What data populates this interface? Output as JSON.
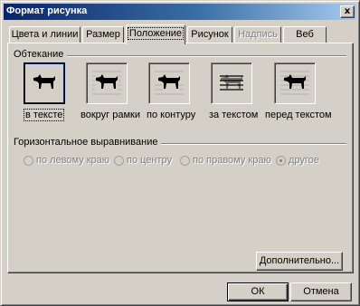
{
  "window": {
    "title": "Формат рисунка",
    "close_label": "x"
  },
  "tabs": [
    {
      "label": "Цвета и линии",
      "state": "normal"
    },
    {
      "label": "Размер",
      "state": "normal"
    },
    {
      "label": "Положение",
      "state": "active"
    },
    {
      "label": "Рисунок",
      "state": "normal"
    },
    {
      "label": "Надпись",
      "state": "disabled"
    },
    {
      "label": "Веб",
      "state": "normal"
    }
  ],
  "wrapping": {
    "group_label": "Обтекание",
    "selected": "в тексте",
    "options": [
      {
        "label": "в тексте",
        "icon": "dog-inline-icon"
      },
      {
        "label": "вокруг рамки",
        "icon": "dog-square-icon"
      },
      {
        "label": "по контуру",
        "icon": "dog-tight-icon"
      },
      {
        "label": "за текстом",
        "icon": "dog-behind-text-icon"
      },
      {
        "label": "перед текстом",
        "icon": "dog-in-front-icon"
      }
    ]
  },
  "alignment": {
    "group_label": "Горизонтальное выравнивание",
    "enabled": false,
    "selected": "другое",
    "options": [
      {
        "label": "по левому краю"
      },
      {
        "label": "по центру"
      },
      {
        "label": "по правому краю"
      },
      {
        "label": "другое"
      }
    ]
  },
  "buttons": {
    "advanced": "Дополнительно...",
    "ok": "ОК",
    "cancel": "Отмена"
  },
  "colors": {
    "title_gradient_start": "#0a246a",
    "title_gradient_end": "#a6caf0",
    "face": "#d4d0c8",
    "disabled_text": "#808080"
  }
}
